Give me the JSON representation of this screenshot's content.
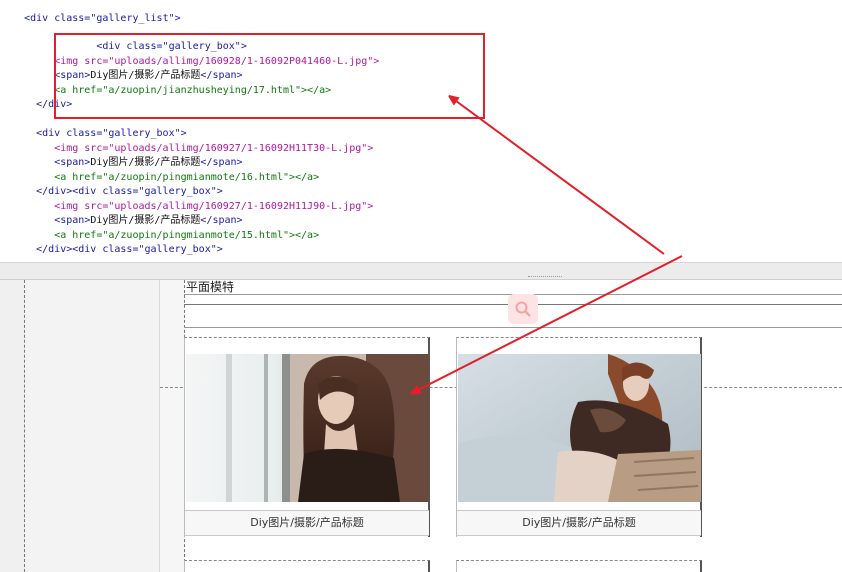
{
  "code_lines": [
    {
      "indent": "    ",
      "parts": [
        {
          "cls": "c-tag",
          "text": "<div class=\"gallery_list\">"
        }
      ]
    },
    {
      "indent": "",
      "parts": []
    },
    {
      "indent": "                ",
      "parts": [
        {
          "cls": "c-tag",
          "text": "<div class=\"gallery_box\">"
        }
      ]
    },
    {
      "indent": "         ",
      "parts": [
        {
          "cls": "c-img",
          "text": "<img src=\"uploads/allimg/160928/1-16092P041460-L.jpg\">"
        }
      ]
    },
    {
      "indent": "         ",
      "parts": [
        {
          "cls": "c-tag",
          "text": "<span>"
        },
        {
          "cls": "c-text",
          "text": "Diy图片/摄影/产品标题"
        },
        {
          "cls": "c-tag",
          "text": "</span>"
        }
      ]
    },
    {
      "indent": "         ",
      "parts": [
        {
          "cls": "c-anchor",
          "text": "<a href=\"a/zuopin/jianzhusheying/17.html\"></a>"
        }
      ]
    },
    {
      "indent": "      ",
      "parts": [
        {
          "cls": "c-tag",
          "text": "</div>"
        }
      ]
    },
    {
      "indent": "",
      "parts": []
    },
    {
      "indent": "      ",
      "parts": [
        {
          "cls": "c-tag",
          "text": "<div class=\"gallery_box\">"
        }
      ]
    },
    {
      "indent": "         ",
      "parts": [
        {
          "cls": "c-img",
          "text": "<img src=\"uploads/allimg/160927/1-16092H11T30-L.jpg\">"
        }
      ]
    },
    {
      "indent": "         ",
      "parts": [
        {
          "cls": "c-tag",
          "text": "<span>"
        },
        {
          "cls": "c-text",
          "text": "Diy图片/摄影/产品标题"
        },
        {
          "cls": "c-tag",
          "text": "</span>"
        }
      ]
    },
    {
      "indent": "         ",
      "parts": [
        {
          "cls": "c-anchor",
          "text": "<a href=\"a/zuopin/pingmianmote/16.html\"></a>"
        }
      ]
    },
    {
      "indent": "      ",
      "parts": [
        {
          "cls": "c-tag",
          "text": "</div><div class=\"gallery_box\">"
        }
      ]
    },
    {
      "indent": "         ",
      "parts": [
        {
          "cls": "c-img",
          "text": "<img src=\"uploads/allimg/160927/1-16092H11J90-L.jpg\">"
        }
      ]
    },
    {
      "indent": "         ",
      "parts": [
        {
          "cls": "c-tag",
          "text": "<span>"
        },
        {
          "cls": "c-text",
          "text": "Diy图片/摄影/产品标题"
        },
        {
          "cls": "c-tag",
          "text": "</span>"
        }
      ]
    },
    {
      "indent": "         ",
      "parts": [
        {
          "cls": "c-anchor",
          "text": "<a href=\"a/zuopin/pingmianmote/15.html\"></a>"
        }
      ]
    },
    {
      "indent": "      ",
      "parts": [
        {
          "cls": "c-tag",
          "text": "</div><div class=\"gallery_box\">"
        }
      ]
    }
  ],
  "design": {
    "page_heading": "平面模特",
    "search_icon": "search-icon",
    "gallery": [
      {
        "caption": "Diy图片/摄影/产品标题",
        "photo": "photo-woman-window"
      },
      {
        "caption": "Diy图片/摄影/产品标题",
        "photo": "photo-woman-fur-sofa"
      }
    ]
  },
  "colors": {
    "annotation_red": "#e21f2a",
    "tag_blue": "#1a1aa6",
    "img_magenta": "#b0169e",
    "anchor_green": "#11780f"
  }
}
